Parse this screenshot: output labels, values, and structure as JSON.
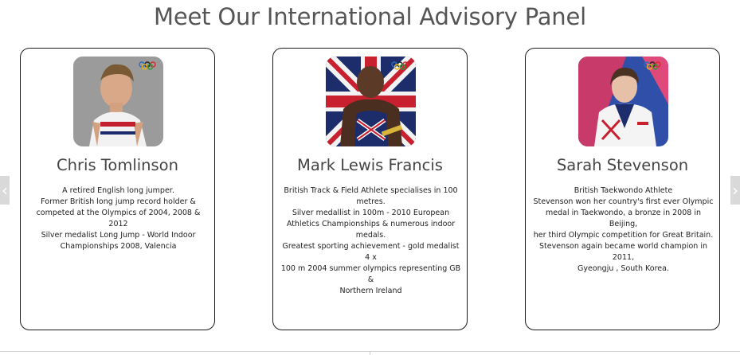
{
  "heading": "Meet Our International Advisory Panel",
  "nav": {
    "prev_icon": "chevron-left-icon",
    "next_icon": "chevron-right-icon"
  },
  "colors": {
    "title": "#555555",
    "card_border": "#1a1a1a",
    "arrow_bg": "#d9d9d9"
  },
  "panel": [
    {
      "name": "Chris Tomlinson",
      "bio": [
        "A retired English long jumper.",
        "Former British long jump record holder &",
        "competed at the Olympics of 2004, 2008 & 2012",
        "Silver medalist Long Jump - World Indoor",
        "Championships 2008, Valencia"
      ]
    },
    {
      "name": "Mark Lewis Francis",
      "bio": [
        "British Track & Field Athlete specialises in 100",
        "metres.",
        "Silver medallist in 100m - 2010 European",
        "Athletics Championships & numerous indoor",
        "medals.",
        "Greatest sporting achievement - gold medalist 4 x",
        "100 m 2004 summer olympics representing GB &",
        "Northern Ireland"
      ]
    },
    {
      "name": "Sarah Stevenson",
      "bio": [
        "British Taekwondo Athlete",
        "Stevenson won her country's first ever Olympic",
        "medal in Taekwondo, a bronze in 2008 in Beijing,",
        "her third Olympic competition for Great Britain.",
        "Stevenson again became world champion in 2011,",
        "Gyeongju , South Korea."
      ]
    }
  ]
}
